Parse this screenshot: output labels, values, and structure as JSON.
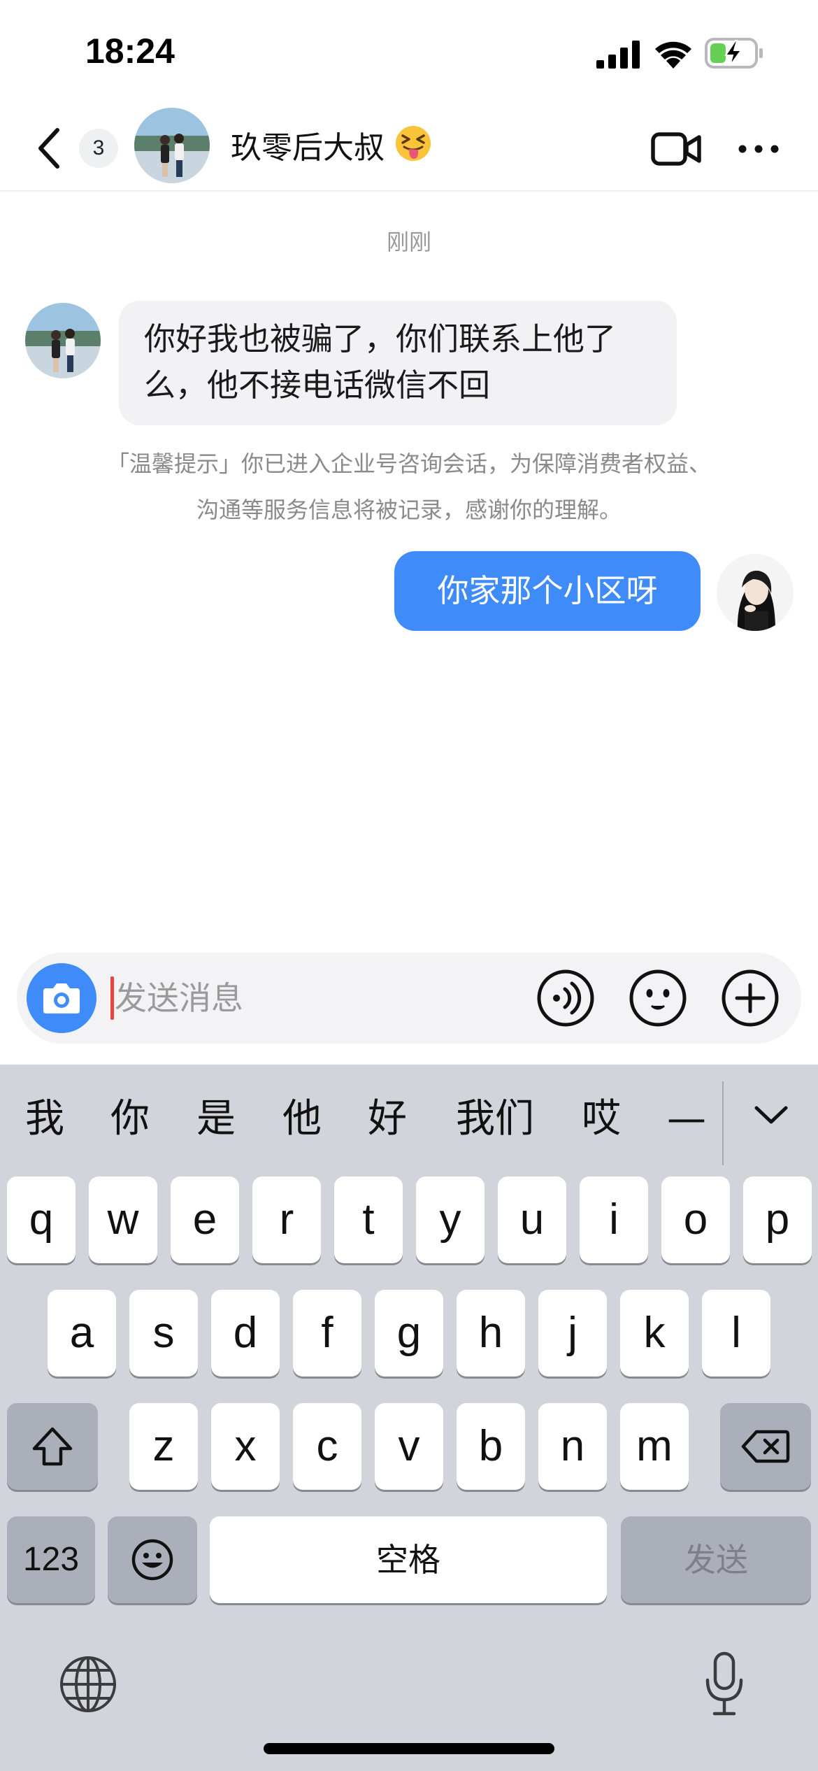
{
  "status_bar": {
    "time": "18:24"
  },
  "header": {
    "unread_count": "3",
    "contact_name": "玖零后大叔",
    "name_emoji": "tongue-squint-emoji"
  },
  "messages": {
    "timestamp": "刚刚",
    "incoming": {
      "text": "你好我也被骗了，你们联系上他了么，他不接电话微信不回"
    },
    "system_notice": "「温馨提示」你已进入企业号咨询会话，为保障消费者权益、沟通等服务信息将被记录，感谢你的理解。",
    "outgoing": {
      "text": "你家那个小区呀"
    }
  },
  "input_bar": {
    "placeholder": "发送消息",
    "value": "",
    "icons": [
      "camera-icon",
      "voice-icon",
      "sticker-icon",
      "plus-icon"
    ]
  },
  "keyboard": {
    "candidates": [
      "我",
      "你",
      "是",
      "他",
      "好",
      "我们",
      "哎",
      "—"
    ],
    "rows": [
      [
        "q",
        "w",
        "e",
        "r",
        "t",
        "y",
        "u",
        "i",
        "o",
        "p"
      ],
      [
        "a",
        "s",
        "d",
        "f",
        "g",
        "h",
        "j",
        "k",
        "l"
      ],
      [
        "z",
        "x",
        "c",
        "v",
        "b",
        "n",
        "m"
      ]
    ],
    "numbers_key": "123",
    "space_key": "空格",
    "send_key": "发送"
  },
  "colors": {
    "accent": "#3f8bfa",
    "incoming_bubble": "#f2f2f4",
    "keyboard_bg": "#d2d4db",
    "battery_green": "#65d055",
    "cursor": "#e8453c"
  }
}
